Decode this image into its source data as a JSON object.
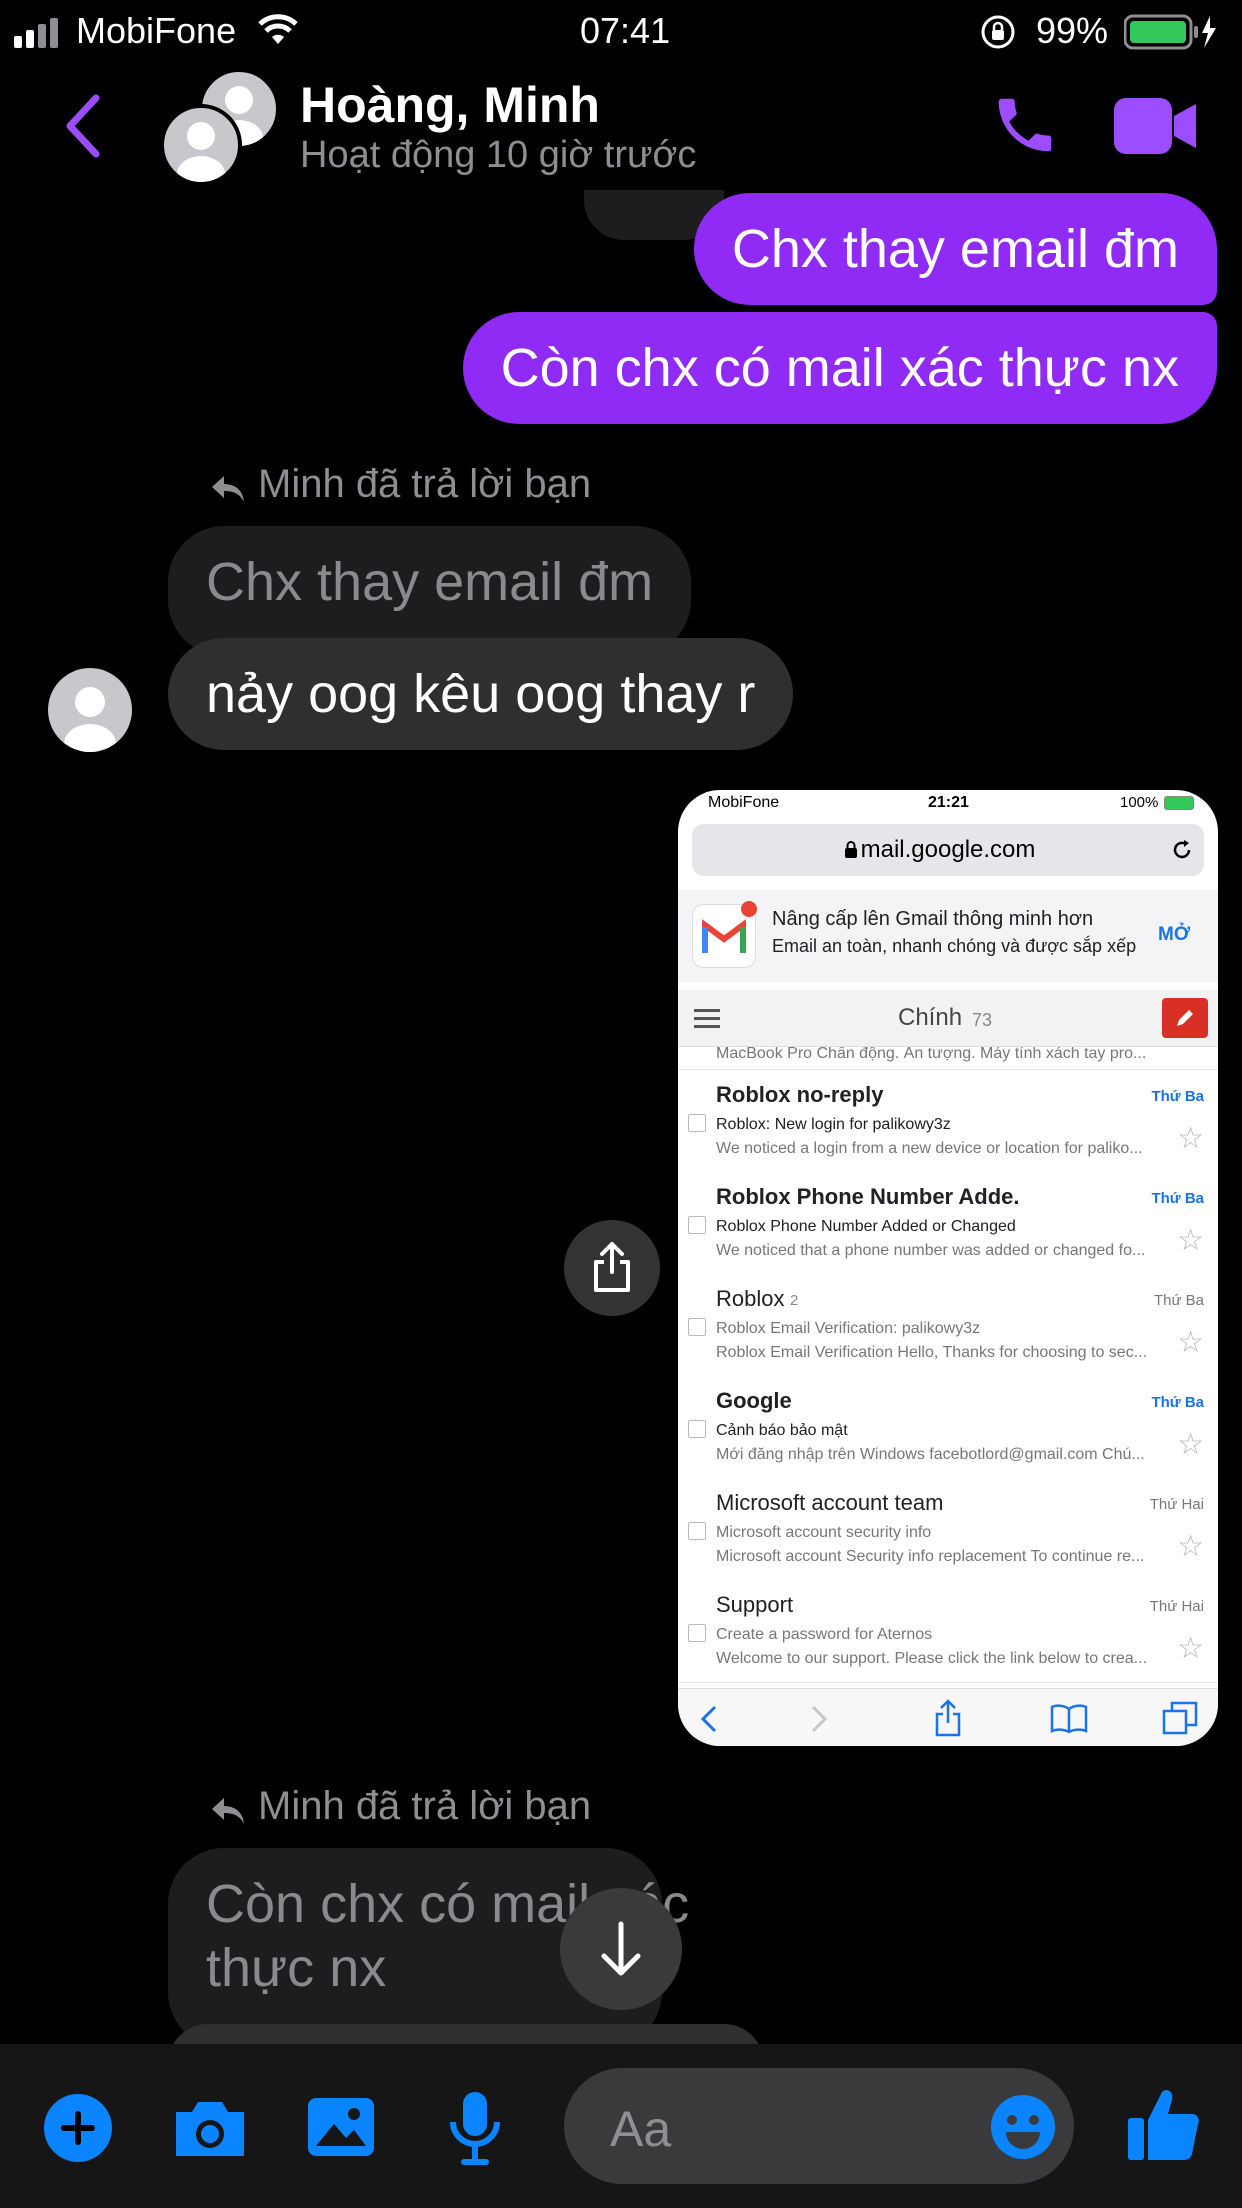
{
  "status_bar": {
    "carrier": "MobiFone",
    "time": "07:41",
    "battery": "99%"
  },
  "header": {
    "contact_name": "Hoàng, Minh",
    "activity": "Hoạt động 10 giờ trước"
  },
  "messages": {
    "out1": "Chx thay email đm",
    "out2": "Còn chx có mail xác thực nx",
    "reply_note1": "Minh đã trả lời bạn",
    "quote1": "Chx thay email đm",
    "in1": "nảy oog kêu oog thay r",
    "reply_note2": "Minh đã trả lời bạn",
    "quote2_line1": "Còn chx có mail xác",
    "quote2_line2": "thực nx"
  },
  "screenshot": {
    "status": {
      "carrier": "MobiFone",
      "time": "21:21",
      "battery": "100%"
    },
    "url": "mail.google.com",
    "promo_title": "Nâng cấp lên Gmail thông minh hơn",
    "promo_sub": "Email an toàn, nhanh chóng và được sắp xếp",
    "promo_open": "MỞ",
    "tab_label": "Chính",
    "tab_count": "73",
    "partial_row": "MacBook Pro Chấn động. Ấn tượng. Máy tính xách tay pro...",
    "emails": [
      {
        "sender": "Roblox no-reply",
        "count": "",
        "subject": "Roblox: New login for palikowy3z",
        "snippet": "We noticed a login from a new device or location for paliko...",
        "date": "Thứ Ba",
        "unread": true
      },
      {
        "sender": "Roblox Phone Number Adde.",
        "count": "",
        "subject": "Roblox Phone Number Added or Changed",
        "snippet": "We noticed that a phone number was added or changed fo...",
        "date": "Thứ Ba",
        "unread": true
      },
      {
        "sender": "Roblox",
        "count": "2",
        "subject": "Roblox Email Verification: palikowy3z",
        "snippet": "Roblox Email Verification Hello, Thanks for choosing to sec...",
        "date": "Thứ Ba",
        "unread": false
      },
      {
        "sender": "Google",
        "count": "",
        "subject": "Cảnh báo bảo mật",
        "snippet": "Mới đăng nhập trên Windows facebotlord@gmail.com Chú...",
        "date": "Thứ Ba",
        "unread": true
      },
      {
        "sender": "Microsoft account team",
        "count": "",
        "subject": "Microsoft account security info",
        "snippet": "Microsoft account Security info replacement To continue re...",
        "date": "Thứ Hai",
        "unread": false
      },
      {
        "sender": "Support",
        "count": "",
        "subject": "Create a password for Aternos",
        "snippet": "Welcome to our support. Please click the link below to crea...",
        "date": "Thứ Hai",
        "unread": false
      }
    ]
  },
  "composer": {
    "placeholder": "Aa"
  },
  "colors": {
    "accent": "#8f2bf5",
    "messenger_blue": "#0a84ff",
    "gmail_compose": "#d93025"
  }
}
